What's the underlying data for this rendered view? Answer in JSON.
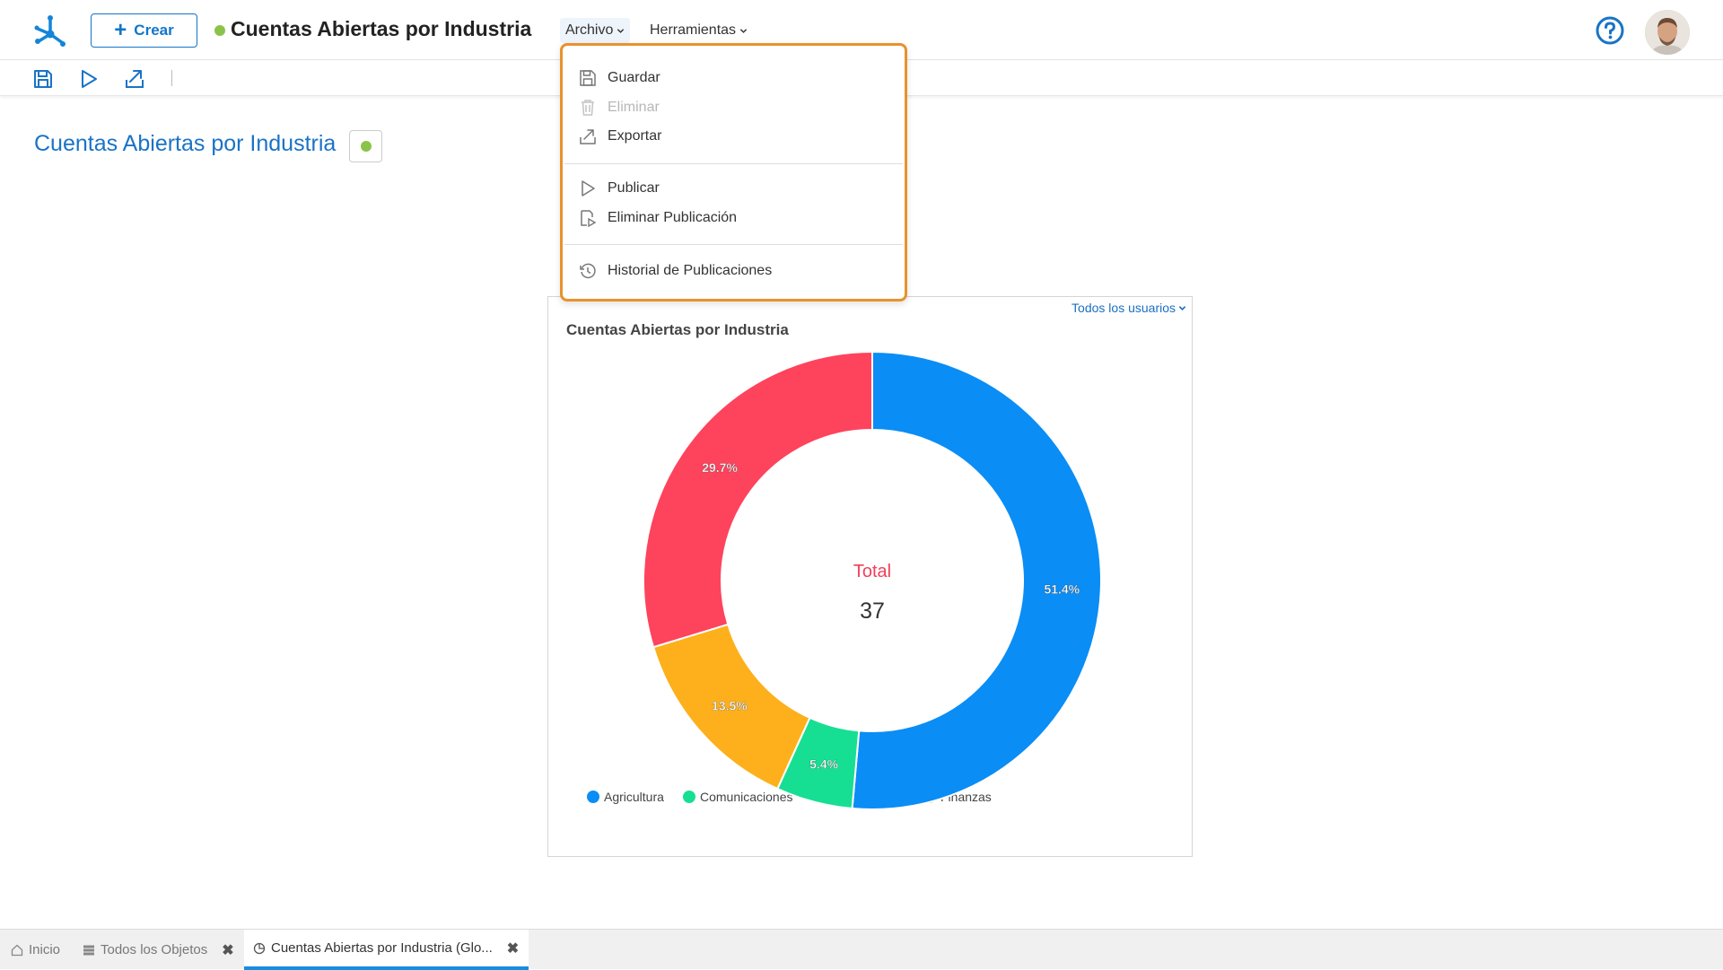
{
  "header": {
    "create_label": "Crear",
    "doc_title": "Cuentas Abiertas por Industria",
    "menus": [
      "Archivo",
      "Herramientas"
    ]
  },
  "toolbar": {
    "icons": [
      "save-icon",
      "play-icon",
      "export-icon"
    ]
  },
  "page": {
    "title": "Cuentas Abiertas por Industria"
  },
  "dropdown": {
    "items": [
      {
        "label": "Guardar",
        "icon": "save-icon",
        "enabled": true
      },
      {
        "label": "Eliminar",
        "icon": "trash-icon",
        "enabled": false
      },
      {
        "label": "Exportar",
        "icon": "export-icon",
        "enabled": true
      },
      {
        "label": "Publicar",
        "icon": "play-icon",
        "enabled": true
      },
      {
        "label": "Eliminar Publicación",
        "icon": "unpublish-icon",
        "enabled": true
      },
      {
        "label": "Historial de Publicaciones",
        "icon": "history-icon",
        "enabled": true
      }
    ]
  },
  "chart_card": {
    "users_filter": "Todos los usuarios"
  },
  "chart_data": {
    "type": "pie",
    "title": "Cuentas Abiertas por Industria",
    "center_label": "Total",
    "center_value": "37",
    "slices": [
      {
        "name": "Finanzas",
        "value": 51.4,
        "label": "51.4%",
        "color": "#0a8df5"
      },
      {
        "name": "Comunicaciones",
        "value": 5.4,
        "label": "5.4%",
        "color": "#16df93"
      },
      {
        "name": "",
        "value": 13.5,
        "label": "13.5%",
        "color": "#fdb01b"
      },
      {
        "name": "",
        "value": 29.7,
        "label": "29.7%",
        "color": "#fe435d"
      }
    ],
    "legend": [
      {
        "label": "Agricultura",
        "color": "#0a8df5"
      },
      {
        "label": "Comunicaciones",
        "color": "#16df93"
      },
      {
        "label": "Finanzas",
        "color": "#fdb01b"
      }
    ],
    "legend_position": "bottom"
  },
  "bottom_tabs": [
    {
      "label": "Inicio",
      "icon": "home-icon",
      "active": false,
      "closable": false
    },
    {
      "label": "Todos los Objetos",
      "icon": "list-icon",
      "active": false,
      "closable": true
    },
    {
      "label": "Cuentas Abiertas por Industria (Glo...",
      "icon": "pie-chart-icon",
      "active": true,
      "closable": true
    }
  ],
  "colors": {
    "accent": "#1275c9",
    "status_green": "#8bc34a",
    "dropdown_border": "#e8922c"
  }
}
